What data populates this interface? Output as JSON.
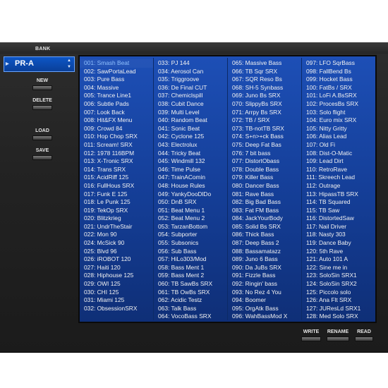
{
  "bank": {
    "label": "BANK",
    "value": "PR-A",
    "marker_icon": "triangle-right-icon",
    "up_icon": "arrow-up-icon",
    "down_icon": "arrow-down-icon"
  },
  "buttons": {
    "new": "NEW",
    "delete": "DELETE",
    "load": "LOAD",
    "save": "SAVE",
    "write": "WRITE",
    "rename": "RENAME",
    "read": "READ"
  },
  "colors": {
    "list_bg": "#1d4fb6",
    "selected_text": "#8fc0ff",
    "bank_bg": "#0d56c6"
  },
  "selected_index": 0,
  "columns": [
    [
      "001: Smash Beat",
      "002: SawPortaLead",
      "003: Pure Bass",
      "004: Massive",
      "005: Trance Line1",
      "006: Subtle Pads",
      "007: Look Back",
      "008: Hit&FX Menu",
      "009: Crowd 84",
      "010: Hop Chop SRX",
      "011: Scream! SRX",
      "012: 1978 116BPM",
      "013: X-Tronic SRX",
      "014: Trans SRX",
      "015: AcidRiff 125",
      "016: FullHous SRX",
      "017: Funk E 125",
      "018: Le Punk 125",
      "019: TekOp SRX",
      "020: Blitzkrieg",
      "021: UndrTheStair",
      "022: Mon 90",
      "024: McSick 90",
      "025: Blvd 96",
      "026: iROBOT 120",
      "027: Haiti 120",
      "028: Hiphouse 125",
      "029: OWI 125",
      "030: CHI 125",
      "031: Miami 125",
      "032: ObsessionSRX"
    ],
    [
      "033: PJ 144",
      "034: Aerosol Can",
      "035: Triggroove",
      "036: De Final CUT",
      "037: Chemiclspill",
      "038: Cubit Dance",
      "039: Multi Level",
      "040: Random Beat",
      "041: Sonic Beat",
      "042: Cyclone 125",
      "043: Electrolux",
      "044: Tricky Beat",
      "045: Windmill 132",
      "046: Time Pulse",
      "047: TrainAComin",
      "048: House Rules",
      "049: YankyDooDlDo",
      "050: DnB SRX",
      "051: Beat Menu 1",
      "052: Beat Menu 2",
      "053: TarzanBottom",
      "054: Subporter",
      "055: Subsonics",
      "056: Sub Bass",
      "057: HiLo303/Mod",
      "058: Bass Ment 1",
      "059: Bass Ment 2",
      "060: TB SawBs SRX",
      "061: TB OwBs SRX",
      "062: Acidic Testz",
      "063: Talk Bass",
      "064: VocoBass SRX"
    ],
    [
      "065: Massive Bass",
      "066: TB Sqr SRX",
      "067: SQR Reso Bs",
      "068: SH-5 Synbass",
      "069: Juno Bs SRX",
      "070: SlippyBs SRX",
      "071: Arrpy Bs SRX",
      "072: TB / SRX",
      "073: TB-notTB SRX",
      "074: S+n>+ck Bass",
      "075: Deep Fat Bas",
      "076: 7 bit bass",
      "077: DistortObass",
      "078: Double Bass",
      "079: Killer Bass",
      "080: Dancer Bass",
      "081: Rave Bass",
      "082: Big Bad Bass",
      "083: Fat FM Bass",
      "084: JackYourBody",
      "085: Solid Bs SRX",
      "086: Thick Bass",
      "087: Deep Bass 2",
      "088: Bassamatazz",
      "089: Juno 6 Bass",
      "090: Da JuBs SRX",
      "091: Fizzle Bass",
      "092: Ringin' bass",
      "093: No Rez 4 You",
      "094: Boomer",
      "095: OrgAtk Bass",
      "096: WahBassMod X"
    ],
    [
      "097: LFO SqrBass",
      "098: FallBend Bs",
      "099: Hocket Bass",
      "100: FatBs / SRX",
      "101: LoFi A.BsSRX",
      "102: ProcesBs SRX",
      "103: Solo flight",
      "104: Euro mix SRX",
      "105: Nitty Gritty",
      "106: Alias Lead",
      "107: Old Fi",
      "108: Dist-O-Matic",
      "109: Lead Dirt",
      "110: RetroRave",
      "111: Skreech Lead",
      "112: Outrage",
      "113: HipassTB SRX",
      "114: TB Squared",
      "115: TB Saw",
      "116: DistortedSaw",
      "117: Nail Driver",
      "118: Nasty 303",
      "119: Dance Baby",
      "120: 5th Rave",
      "121: Auto 101 A",
      "122: Sine me in",
      "123: SoloSin SRX1",
      "124: SoloSin SRX2",
      "125: Piccolo solo",
      "126: Ana Flt SRX",
      "127: JUResLd SRX1",
      "128: Med Solo SRX"
    ]
  ]
}
